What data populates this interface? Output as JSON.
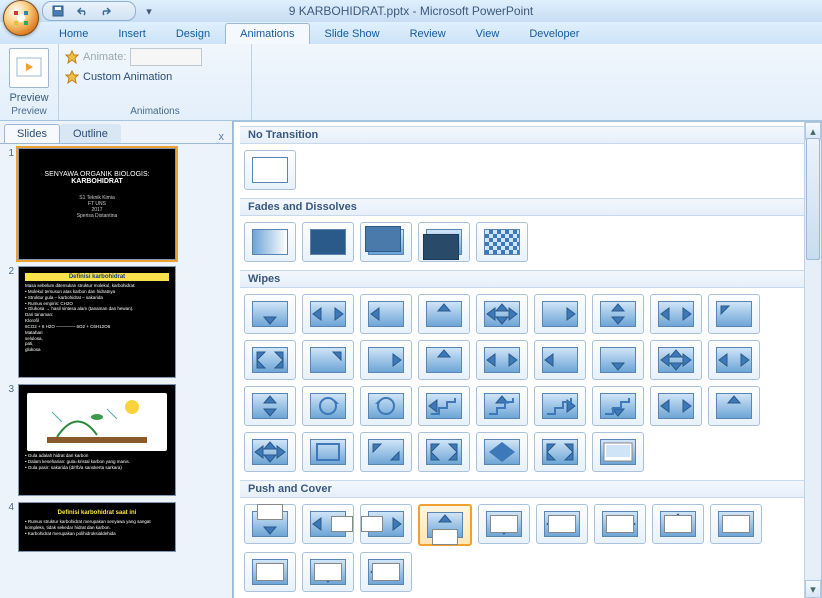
{
  "window_title": "9 KARBOHIDRAT.pptx - Microsoft PowerPoint",
  "tabs": {
    "home": "Home",
    "insert": "Insert",
    "design": "Design",
    "animations": "Animations",
    "slideshow": "Slide Show",
    "review": "Review",
    "view": "View",
    "developer": "Developer"
  },
  "ribbon": {
    "preview": "Preview",
    "animate_label": "Animate:",
    "custom_anim": "Custom Animation",
    "grp_preview": "Preview",
    "grp_anim": "Animations"
  },
  "pane": {
    "slides": "Slides",
    "outline": "Outline",
    "close": "x"
  },
  "slides": [
    {
      "n": "1",
      "title": "SENYAWA ORGANIK BIOLOGIS:",
      "sub": "KARBOHIDRAT",
      "meta": "S1 Teknik Kimia\nFT UNS\n2017\nSperisa Distantina"
    },
    {
      "n": "2",
      "head": "Definisi karbohidrat",
      "body": "Masa sebelum ditemukan struktur molekul, karbohidrat:\n• Molekul tersusun atas karbon dan hidratnya\n• Struktur gula – karbohidrat – sakarida\n• Rumus empiris: CH2O\n• Glukosa → hasil sintesa alam (tanaman dan hewan).\nDari tanaman:\n                Klorofil\n6CO2 + 6 H2O ────── 6O2 + C6H12O6\n               Matahari\n                         selulosa,\n                         pati,\n                         glukosa"
    },
    {
      "n": "3",
      "body": "• Gula adalah hidrat dari karbon\n• Dalam keseharian: gula=kristal karbon yang manis.\n• Gula pasir: sakarida (d/r/b/a sanskerta sarkara)"
    },
    {
      "n": "4",
      "head": "Definisi karbohidrat saat ini",
      "body": "• Rumus struktur karbohidrat merupakan senyawa yang sangat kompleks, tidak sekedar hidrat dan karbon.\n• Karbohidrat merupakan polihidroksialdehida"
    }
  ],
  "gallery": {
    "no_transition": "No Transition",
    "fades": "Fades and Dissolves",
    "wipes": "Wipes",
    "push": "Push and Cover"
  }
}
